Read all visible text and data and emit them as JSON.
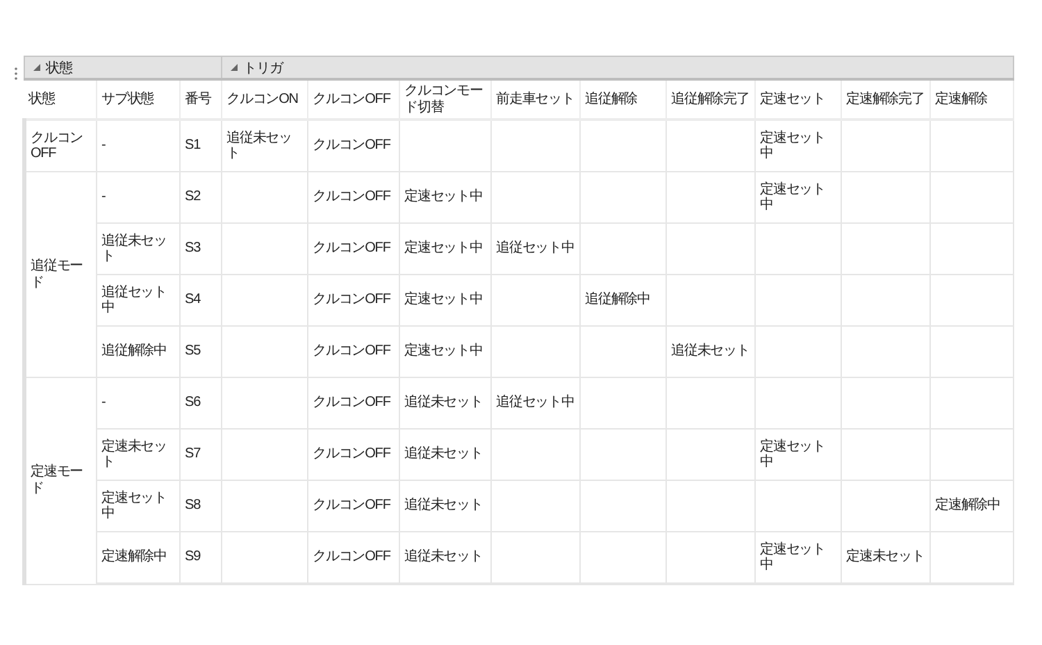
{
  "bands": [
    "状態",
    "トリガ"
  ],
  "columns": [
    "状態",
    "サブ状態",
    "番号",
    "クルコンON",
    "クルコンOFF",
    "クルコンモード切替",
    "前走車セット",
    "追従解除",
    "追従解除完了",
    "定速セット",
    "定速解除完了",
    "定速解除"
  ],
  "groups": [
    {
      "state": "クルコンOFF",
      "rows": [
        {
          "sub": "-",
          "number": "S1",
          "triggers": {
            "cruise_on": "追従未セット",
            "cruise_off": "クルコンOFF",
            "constant_set": "定速セット中"
          }
        }
      ]
    },
    {
      "state": "追従モード",
      "rows": [
        {
          "sub": "-",
          "number": "S2",
          "triggers": {
            "cruise_off": "クルコンOFF",
            "mode_switch": "定速セット中",
            "constant_set": "定速セット中"
          }
        },
        {
          "sub": "追従未セット",
          "number": "S3",
          "triggers": {
            "cruise_off": "クルコンOFF",
            "mode_switch": "定速セット中",
            "lead_car_set": "追従セット中"
          }
        },
        {
          "sub": "追従セット中",
          "number": "S4",
          "triggers": {
            "cruise_off": "クルコンOFF",
            "mode_switch": "定速セット中",
            "follow_release": "追従解除中"
          }
        },
        {
          "sub": "追従解除中",
          "number": "S5",
          "triggers": {
            "cruise_off": "クルコンOFF",
            "mode_switch": "定速セット中",
            "follow_release_done": "追従未セット"
          }
        }
      ]
    },
    {
      "state": "定速モード",
      "rows": [
        {
          "sub": "-",
          "number": "S6",
          "triggers": {
            "cruise_off": "クルコンOFF",
            "mode_switch": "追従未セット",
            "lead_car_set": "追従セット中"
          }
        },
        {
          "sub": "定速未セット",
          "number": "S7",
          "triggers": {
            "cruise_off": "クルコンOFF",
            "mode_switch": "追従未セット",
            "constant_set": "定速セット中"
          }
        },
        {
          "sub": "定速セット中",
          "number": "S8",
          "triggers": {
            "cruise_off": "クルコンOFF",
            "mode_switch": "追従未セット",
            "constant_release": "定速解除中"
          }
        },
        {
          "sub": "定速解除中",
          "number": "S9",
          "triggers": {
            "cruise_off": "クルコンOFF",
            "mode_switch": "追従未セット",
            "constant_set": "定速セット中",
            "constant_release_done": "定速未セット"
          }
        }
      ]
    }
  ]
}
